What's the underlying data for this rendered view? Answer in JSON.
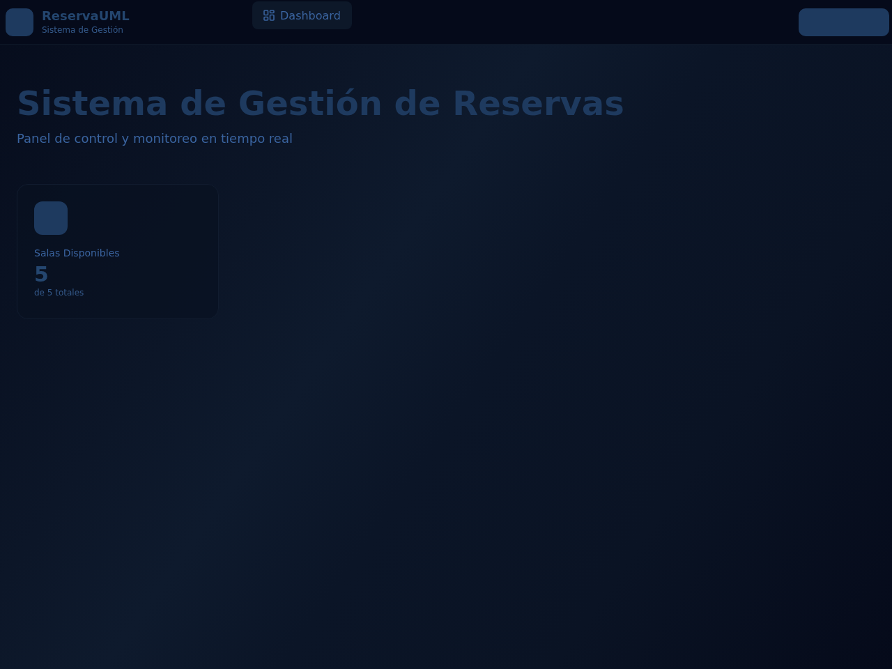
{
  "header": {
    "brand": {
      "name": "ReservaUML",
      "subtitle": "Sistema de Gestión"
    },
    "nav": [
      {
        "label": "Dashboard",
        "selected": true
      }
    ]
  },
  "page": {
    "title": "Sistema de Gestión de Reservas",
    "subtitle": "Panel de control y monitoreo en tiempo real"
  },
  "stats": [
    {
      "label": "Salas Disponibles",
      "value": "5",
      "detail": "de 5 totales"
    }
  ]
}
